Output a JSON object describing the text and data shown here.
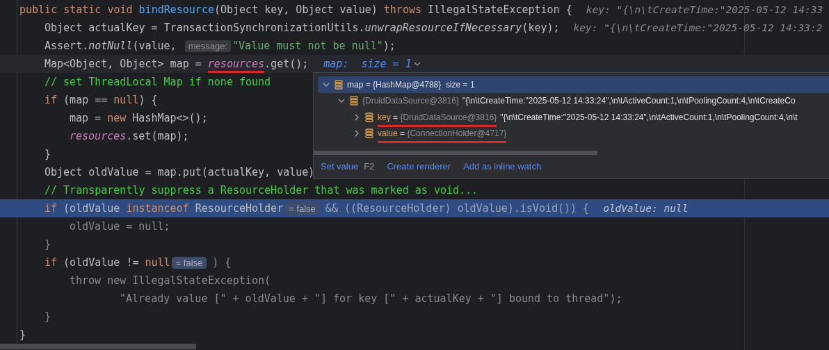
{
  "editor": {
    "lines": [
      {
        "caret": false,
        "execution_point": false,
        "segments": [
          {
            "kind": "keyword",
            "text": "public static void "
          },
          {
            "kind": "function",
            "text": "bindResource"
          },
          {
            "kind": "text",
            "text": "(Object key, Object value) "
          },
          {
            "kind": "keyword",
            "text": "throws "
          },
          {
            "kind": "text",
            "text": "IllegalStateException {"
          },
          {
            "kind": "inline-value",
            "text": "key: \"{\\n\\tCreateTime:\"2025-05-12 14:33"
          }
        ],
        "children": [
          {
            "caret": false,
            "execution_point": false,
            "segments": [
              {
                "kind": "text",
                "text": "Object actualKey = TransactionSynchronizationUtils."
              },
              {
                "kind": "static-call",
                "text": "unwrapResourceIfNecessary"
              },
              {
                "kind": "text",
                "text": "(key);"
              },
              {
                "kind": "inline-value",
                "text": "key: \"{\\n\\tCreateTime:\"2025-05-12 14:33:2"
              }
            ]
          },
          {
            "caret": false,
            "execution_point": false,
            "segments": [
              {
                "kind": "text",
                "text": "Assert."
              },
              {
                "kind": "static-call",
                "text": "notNull"
              },
              {
                "kind": "text",
                "text": "(value, "
              },
              {
                "kind": "param-hint",
                "text": "message:"
              },
              {
                "kind": "string",
                "text": "\"Value must not be null\""
              },
              {
                "kind": "text",
                "text": ");"
              }
            ]
          },
          {
            "caret": true,
            "execution_point": false,
            "segments": [
              {
                "kind": "text",
                "text": "Map<Object, Object> map = "
              },
              {
                "kind": "field",
                "text": "resources",
                "underlined": true
              },
              {
                "kind": "text",
                "text": ".get();"
              },
              {
                "kind": "inline-watch",
                "text": "map:  size = 1"
              }
            ]
          },
          {
            "caret": false,
            "execution_point": false,
            "segments": [
              {
                "kind": "comment",
                "text": "// set ThreadLocal Map if none found"
              }
            ]
          },
          {
            "caret": false,
            "execution_point": false,
            "segments": [
              {
                "kind": "keyword",
                "text": "if "
              },
              {
                "kind": "text",
                "text": "(map == "
              },
              {
                "kind": "keyword",
                "text": "null"
              },
              {
                "kind": "text",
                "text": ") {"
              }
            ],
            "children": [
              {
                "caret": false,
                "execution_point": false,
                "segments": [
                  {
                    "kind": "text",
                    "text": "map = "
                  },
                  {
                    "kind": "keyword",
                    "text": "new "
                  },
                  {
                    "kind": "text",
                    "text": "HashMap<>();"
                  }
                ]
              },
              {
                "caret": false,
                "execution_point": false,
                "segments": [
                  {
                    "kind": "field",
                    "text": "resources",
                    "underlined": false
                  },
                  {
                    "kind": "text",
                    "text": ".set(map);"
                  }
                ]
              }
            ]
          },
          {
            "caret": false,
            "execution_point": false,
            "segments": [
              {
                "kind": "text",
                "text": "}"
              }
            ]
          },
          {
            "caret": false,
            "execution_point": false,
            "segments": [
              {
                "kind": "text",
                "text": "Object oldValue = map.put(actualKey, value)"
              }
            ]
          },
          {
            "caret": false,
            "execution_point": false,
            "segments": [
              {
                "kind": "comment",
                "text": "// Transparently suppress a ResourceHolder that was marked as void..."
              }
            ]
          },
          {
            "caret": false,
            "execution_point": true,
            "segments": [
              {
                "kind": "keyword",
                "text": "if "
              },
              {
                "kind": "text",
                "text": "(oldValue "
              },
              {
                "kind": "keyword",
                "text": "instanceof "
              },
              {
                "kind": "text",
                "text": "ResourceHolder"
              },
              {
                "kind": "value-badge",
                "text": "= false"
              },
              {
                "kind": "dim",
                "text": "&& ((ResourceHolder) oldValue).isVoid()) {"
              },
              {
                "kind": "inline-value",
                "text": "oldValue: null"
              }
            ],
            "children": [
              {
                "caret": false,
                "execution_point": false,
                "segments": [
                  {
                    "kind": "dim",
                    "text": "oldValue = null;"
                  }
                ]
              }
            ]
          },
          {
            "caret": false,
            "execution_point": false,
            "segments": [
              {
                "kind": "dim",
                "text": "}"
              }
            ]
          },
          {
            "caret": false,
            "execution_point": false,
            "segments": [
              {
                "kind": "keyword",
                "text": "if "
              },
              {
                "kind": "text",
                "text": "(oldValue != "
              },
              {
                "kind": "keyword",
                "text": "null"
              },
              {
                "kind": "value-badge",
                "text": "= false"
              },
              {
                "kind": "dim",
                "text": ") {"
              }
            ],
            "children": [
              {
                "caret": false,
                "execution_point": false,
                "segments": [
                  {
                    "kind": "dim",
                    "text": "throw new IllegalStateException("
                  }
                ],
                "children": [
                  {
                    "caret": false,
                    "execution_point": false,
                    "segments": [
                      {
                        "kind": "dim",
                        "text": "\"Already value [\" + oldValue + \"] for key [\" + actualKey + \"] bound to thread\");"
                      }
                    ]
                  }
                ]
              }
            ]
          },
          {
            "caret": false,
            "execution_point": false,
            "segments": [
              {
                "kind": "dim",
                "text": "}"
              }
            ]
          }
        ]
      },
      {
        "caret": false,
        "execution_point": false,
        "segments": [
          {
            "kind": "text",
            "text": "}"
          }
        ]
      }
    ]
  },
  "popup": {
    "rows": [
      {
        "selected": true,
        "expanded": true,
        "label": [
          {
            "kind": "plain",
            "text": "map = {HashMap@4788}  size = 1"
          }
        ],
        "children": [
          {
            "selected": false,
            "expanded": true,
            "label": [
              {
                "kind": "type",
                "text": "{DruidDataSource@3816}"
              }
            ],
            "value": "\"{\\n\\tCreateTime:\"2025-05-12 14:33:24\",\\n\\tActiveCount:1,\\n\\tPoolingCount:4,\\n\\tCreateCo",
            "children": [
              {
                "selected": false,
                "expanded": false,
                "underlined": true,
                "label": [
                  {
                    "kind": "name",
                    "text": "key"
                  },
                  {
                    "kind": "plain",
                    "text": " = "
                  },
                  {
                    "kind": "type",
                    "text": "{DruidDataSource@3816}"
                  }
                ],
                "value": "\"{\\n\\tCreateTime:\"2025-05-12 14:33:24\",\\n\\tActiveCount:1,\\n\\tPoolingCount:4,\\n\\t"
              },
              {
                "selected": false,
                "expanded": false,
                "underlined": true,
                "label": [
                  {
                    "kind": "name",
                    "text": "value"
                  },
                  {
                    "kind": "plain",
                    "text": " = "
                  },
                  {
                    "kind": "type",
                    "text": "{ConnectionHolder@4717}"
                  }
                ]
              }
            ]
          }
        ]
      }
    ],
    "actions": [
      {
        "label": "Set value",
        "shortcut": "F2"
      },
      {
        "label": "Create renderer"
      },
      {
        "label": "Add as inline watch"
      }
    ]
  }
}
